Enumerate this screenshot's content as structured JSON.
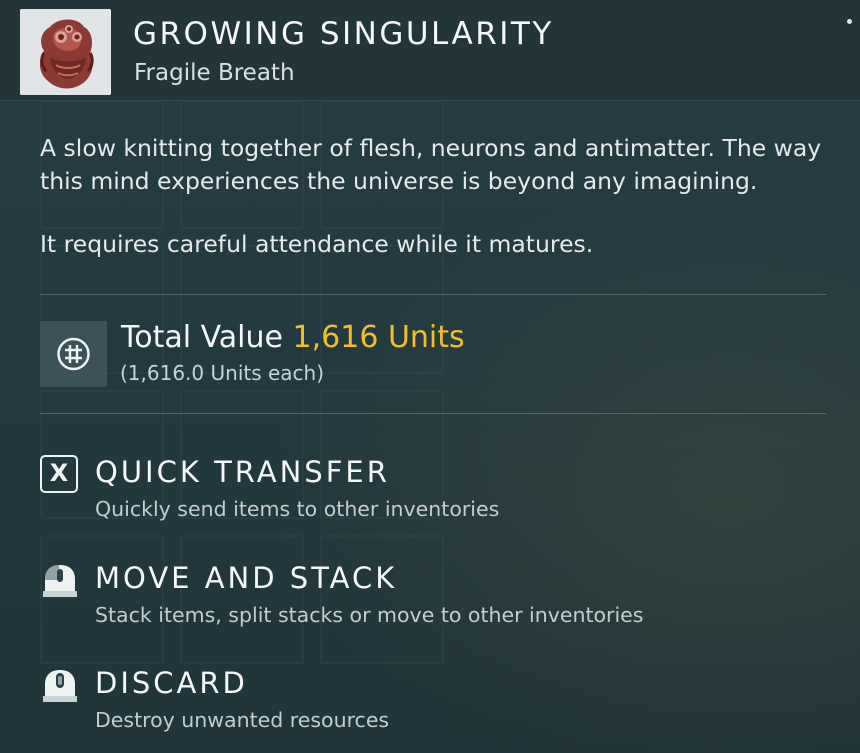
{
  "item": {
    "title": "GROWING SINGULARITY",
    "subtitle": "Fragile Breath",
    "icon": "growing-singularity-icon"
  },
  "description": {
    "paragraph_1": "A slow knitting together of flesh, neurons and antimatter. The way this mind experiences the universe is beyond any imagining.",
    "paragraph_2": "It requires careful attendance while it matures."
  },
  "value": {
    "label": "Total Value",
    "amount": "1,616 Units",
    "each": "(1,616.0 Units each)",
    "icon": "units-currency-icon",
    "accent_color": "#f2be2a"
  },
  "actions": [
    {
      "title": "QUICK TRANSFER",
      "description": "Quickly send items to other inventories",
      "key": "X",
      "icon": "x-key-icon"
    },
    {
      "title": "MOVE AND STACK",
      "description": "Stack items, split stacks or move to other inventories",
      "icon": "mouse-left-click-icon"
    },
    {
      "title": "DISCARD",
      "description": "Destroy unwanted resources",
      "icon": "mouse-middle-click-icon"
    }
  ]
}
